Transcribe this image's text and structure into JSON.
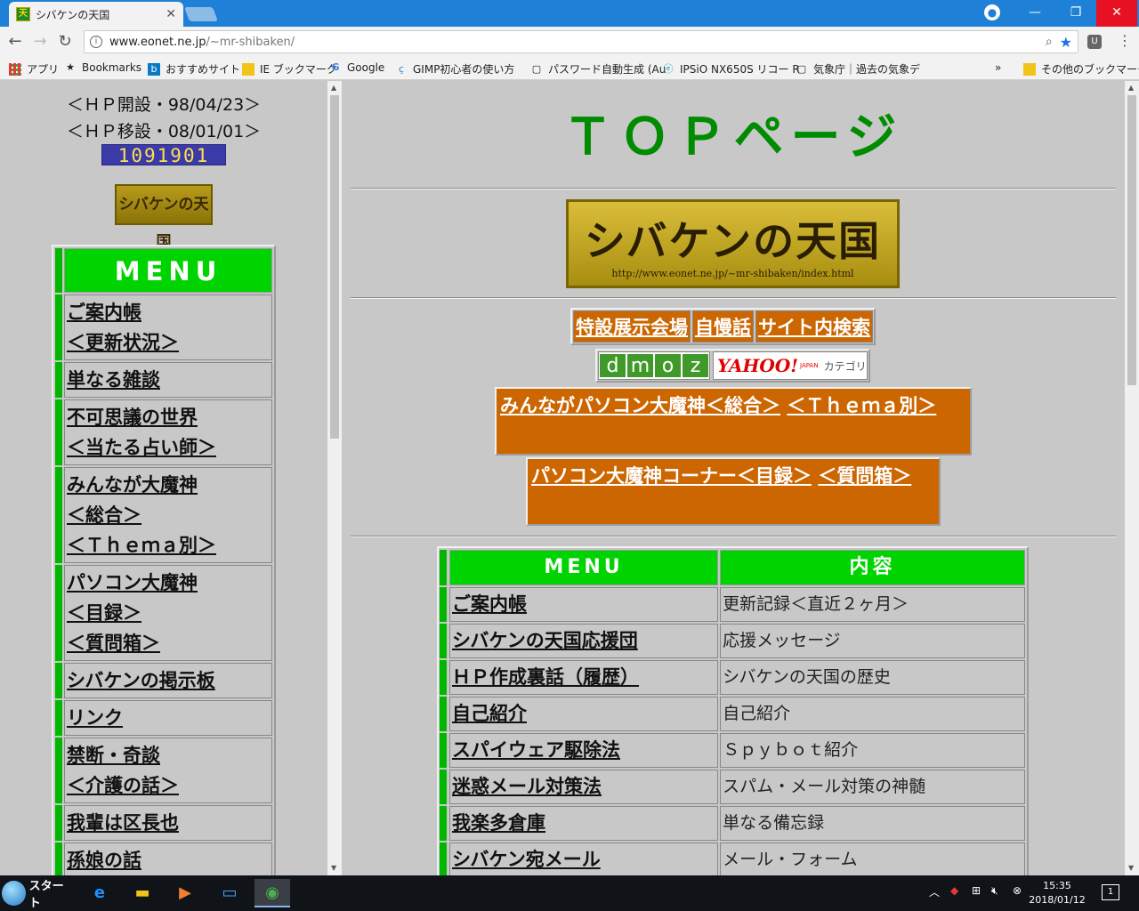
{
  "browser": {
    "tab_title": "シバケンの天国",
    "url_host": "www.eonet.ne.jp",
    "url_path": "/~mr-shibaken/",
    "bookmarks": [
      "アプリ",
      "Bookmarks",
      "おすすめサイト",
      "IE ブックマーク",
      "Google",
      "GIMP初心者の使い方",
      "パスワード自動生成 (Au",
      "IPSiO NX650S リコー R",
      "気象庁｜過去の気象デ",
      "その他のブックマーク"
    ]
  },
  "left": {
    "open_date": "＜ＨＰ開設・98/04/23＞",
    "move_date": "＜ＨＰ移設・08/01/01＞",
    "counter": "1091901",
    "small_logo": "シバケンの天国",
    "menu_title": "MENU",
    "menu": [
      [
        "ご案内帳",
        "＜更新状況＞"
      ],
      [
        "単なる雑談"
      ],
      [
        "不可思議の世界",
        "＜当たる占い師＞"
      ],
      [
        "みんなが大魔神",
        "＜総合＞",
        "＜Ｔｈｅｍａ別＞"
      ],
      [
        "パソコン大魔神",
        "＜目録＞",
        "＜質問箱＞"
      ],
      [
        "シバケンの掲示板"
      ],
      [
        "リンク"
      ],
      [
        "禁断・奇談",
        "＜介護の話＞"
      ],
      [
        "我輩は区長也"
      ],
      [
        "孫娘の話"
      ]
    ]
  },
  "main": {
    "title": "ＴＯＰページ",
    "logo_text": "シバケンの天国",
    "logo_url": "http://www.eonet.ne.jp/~mr-shibaken/index.html",
    "buttons": [
      "特設展示会場",
      "自慢話",
      "サイト内検索"
    ],
    "dmoz": [
      "d",
      "m",
      "o",
      "z"
    ],
    "yahoo": "YAHOO!",
    "yahoo_sub": "JAPAN",
    "yahoo_cat": "カテゴリ",
    "box1": [
      "みんながパソコン大魔神＜総合＞",
      "＜Ｔｈｅｍａ別＞"
    ],
    "box2": [
      "パソコン大魔神コーナー＜目録＞",
      "＜質問箱＞"
    ],
    "table_head": [
      "MENU",
      "内容"
    ],
    "table": [
      [
        "ご案内帳",
        "更新記録＜直近２ヶ月＞"
      ],
      [
        "シバケンの天国応援団",
        "応援メッセージ"
      ],
      [
        "ＨＰ作成裏話（履歴）",
        "シバケンの天国の歴史"
      ],
      [
        "自己紹介",
        "自己紹介"
      ],
      [
        "スパイウェア駆除法",
        "Ｓｐｙｂｏｔ紹介"
      ],
      [
        "迷惑メール対策法",
        "スパム・メール対策の神髄"
      ],
      [
        "我楽多倉庫",
        "単なる備忘録"
      ],
      [
        "シバケン宛メール",
        "メール・フォーム"
      ]
    ]
  },
  "taskbar": {
    "start": "スタート",
    "time": "15:35",
    "date": "2018/01/12",
    "notif_count": "1"
  }
}
